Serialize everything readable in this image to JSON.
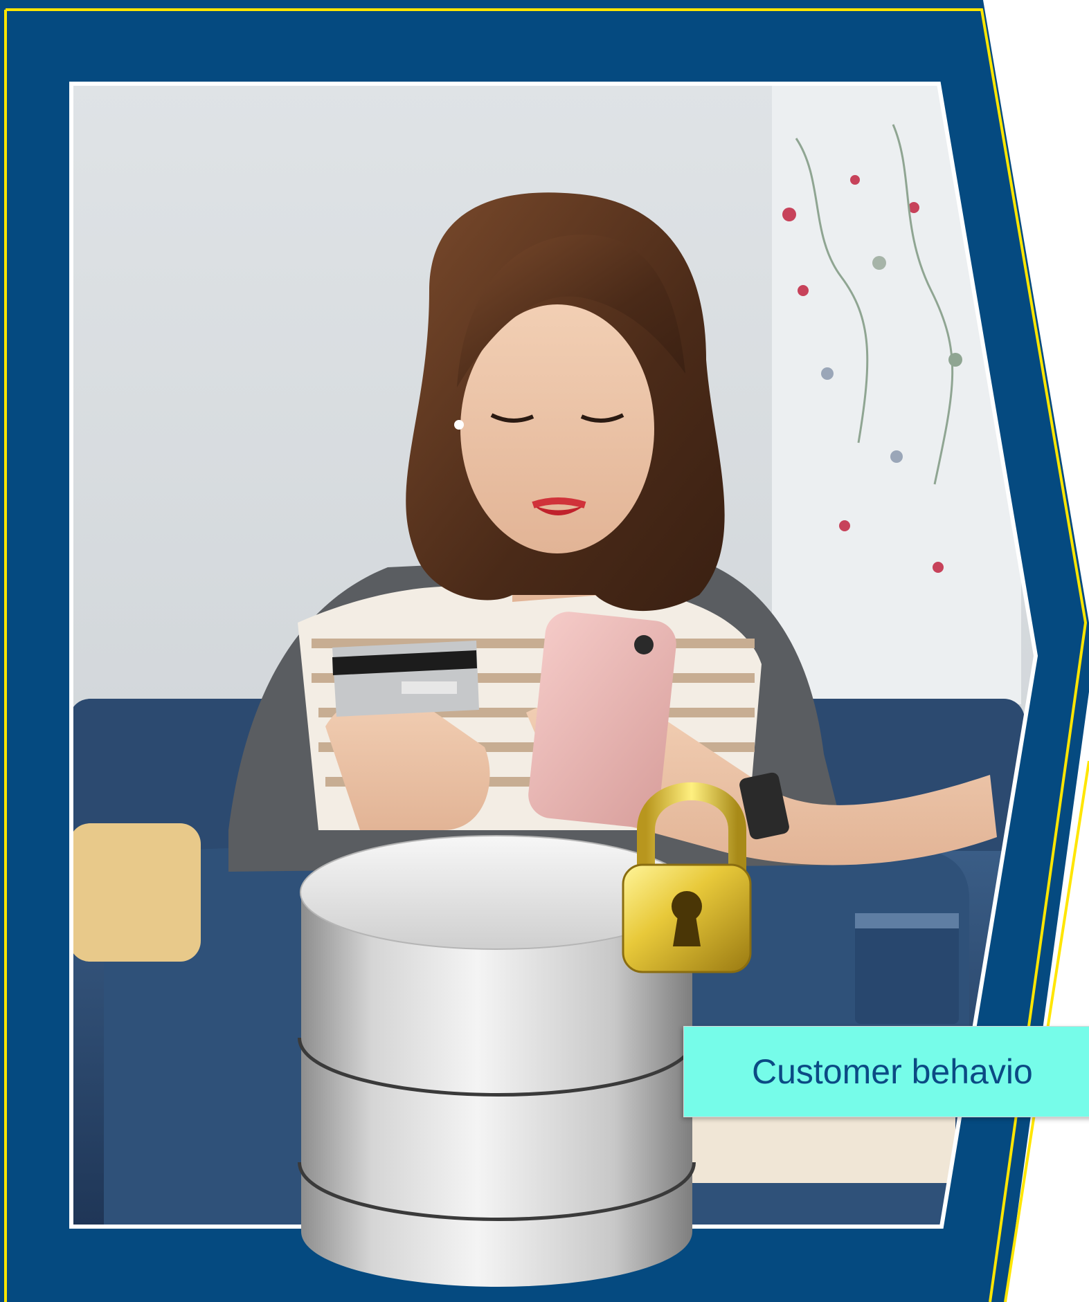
{
  "slide": {
    "frame_color": "#054a80",
    "frame_accent": "#ffe600",
    "photo_subject": "smiling-woman-holding-credit-card-and-smartphone-on-sofa",
    "icons": [
      "database-icon",
      "padlock-icon"
    ]
  },
  "caption": {
    "text": "Customer behavio",
    "background": "#76fce9",
    "text_color": "#0b4a84"
  }
}
